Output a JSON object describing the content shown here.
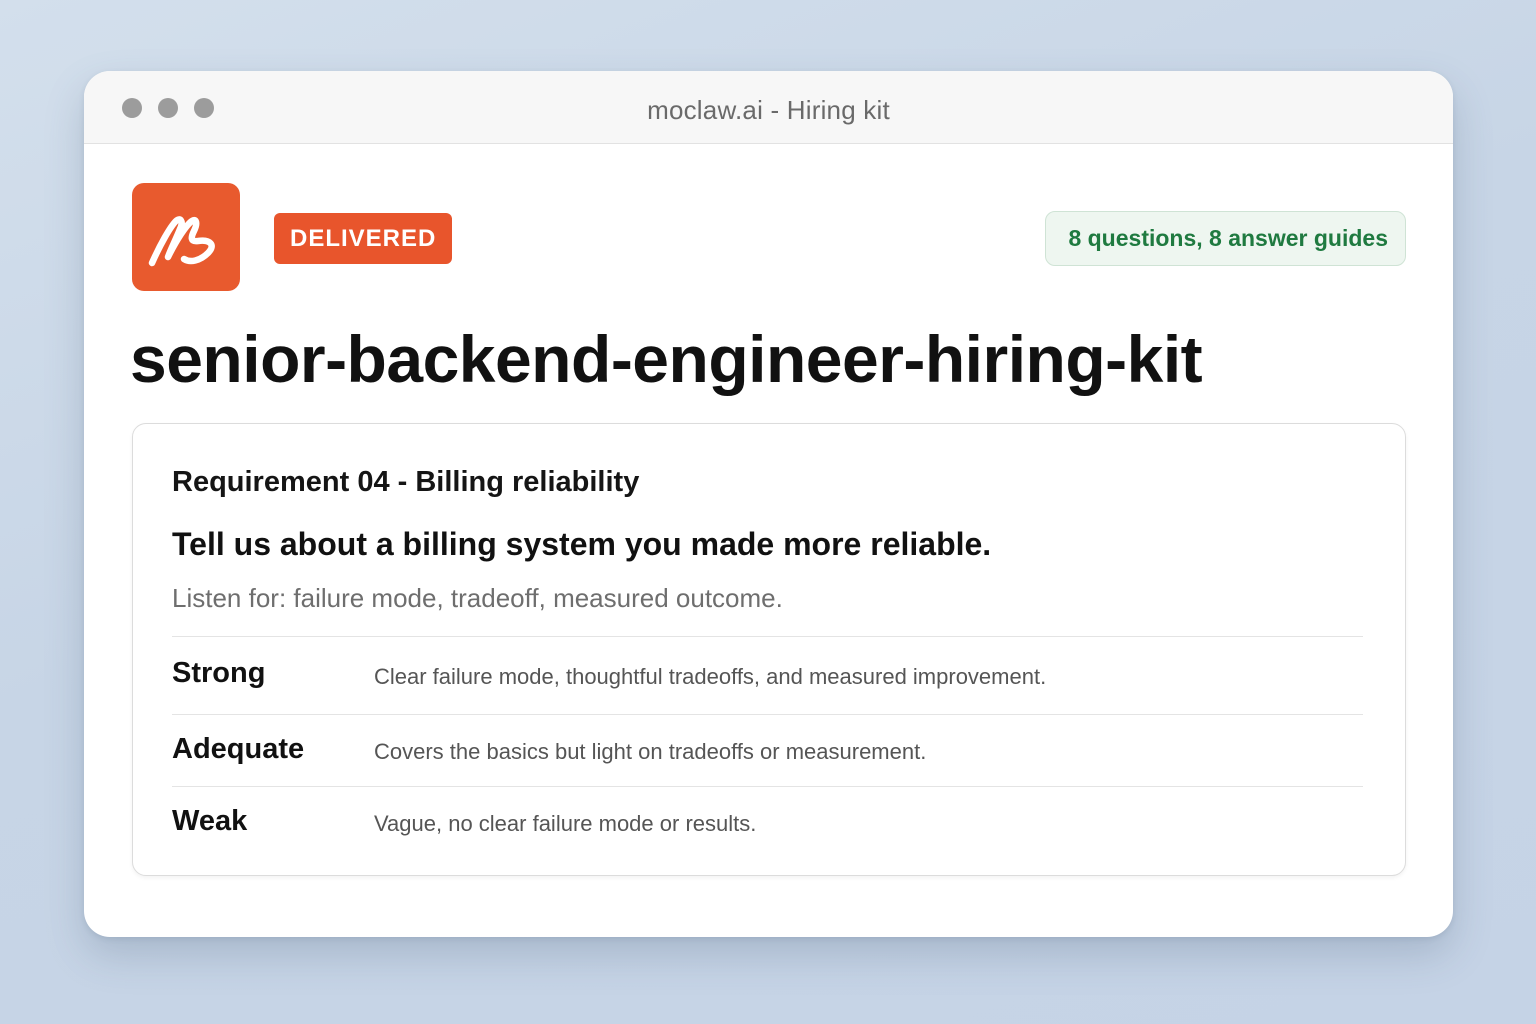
{
  "window": {
    "title": "moclaw.ai - Hiring kit"
  },
  "header": {
    "logo_icon": "moclaw-signature-logo-icon",
    "status_badge": "DELIVERED",
    "summary_pill": "8 questions, 8 answer guides"
  },
  "page_title": "senior-backend-engineer-hiring-kit",
  "card": {
    "requirement": "Requirement 04 - Billing reliability",
    "question": "Tell us about a billing system you made more reliable.",
    "listen_for": "Listen for: failure mode, tradeoff, measured outcome.",
    "rubric": [
      {
        "level": "Strong",
        "description": "Clear failure mode, thoughtful tradeoffs, and measured improvement."
      },
      {
        "level": "Adequate",
        "description": "Covers the basics but light on tradeoffs or measurement."
      },
      {
        "level": "Weak",
        "description": "Vague, no clear failure mode or results."
      }
    ]
  },
  "colors": {
    "accent": "#e8552c",
    "pill_text": "#1f7a40",
    "pill_bg": "#eef6f0"
  }
}
